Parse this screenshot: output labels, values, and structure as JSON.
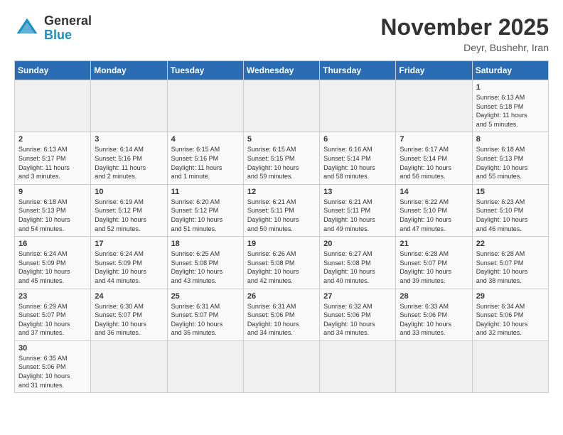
{
  "header": {
    "logo_general": "General",
    "logo_blue": "Blue",
    "month_title": "November 2025",
    "location": "Deyr, Bushehr, Iran"
  },
  "days_of_week": [
    "Sunday",
    "Monday",
    "Tuesday",
    "Wednesday",
    "Thursday",
    "Friday",
    "Saturday"
  ],
  "weeks": [
    [
      {
        "day": "",
        "info": ""
      },
      {
        "day": "",
        "info": ""
      },
      {
        "day": "",
        "info": ""
      },
      {
        "day": "",
        "info": ""
      },
      {
        "day": "",
        "info": ""
      },
      {
        "day": "",
        "info": ""
      },
      {
        "day": "1",
        "info": "Sunrise: 6:13 AM\nSunset: 5:18 PM\nDaylight: 11 hours\nand 5 minutes."
      }
    ],
    [
      {
        "day": "2",
        "info": "Sunrise: 6:13 AM\nSunset: 5:17 PM\nDaylight: 11 hours\nand 3 minutes."
      },
      {
        "day": "3",
        "info": "Sunrise: 6:14 AM\nSunset: 5:16 PM\nDaylight: 11 hours\nand 2 minutes."
      },
      {
        "day": "4",
        "info": "Sunrise: 6:15 AM\nSunset: 5:16 PM\nDaylight: 11 hours\nand 1 minute."
      },
      {
        "day": "5",
        "info": "Sunrise: 6:15 AM\nSunset: 5:15 PM\nDaylight: 10 hours\nand 59 minutes."
      },
      {
        "day": "6",
        "info": "Sunrise: 6:16 AM\nSunset: 5:14 PM\nDaylight: 10 hours\nand 58 minutes."
      },
      {
        "day": "7",
        "info": "Sunrise: 6:17 AM\nSunset: 5:14 PM\nDaylight: 10 hours\nand 56 minutes."
      },
      {
        "day": "8",
        "info": "Sunrise: 6:18 AM\nSunset: 5:13 PM\nDaylight: 10 hours\nand 55 minutes."
      }
    ],
    [
      {
        "day": "9",
        "info": "Sunrise: 6:18 AM\nSunset: 5:13 PM\nDaylight: 10 hours\nand 54 minutes."
      },
      {
        "day": "10",
        "info": "Sunrise: 6:19 AM\nSunset: 5:12 PM\nDaylight: 10 hours\nand 52 minutes."
      },
      {
        "day": "11",
        "info": "Sunrise: 6:20 AM\nSunset: 5:12 PM\nDaylight: 10 hours\nand 51 minutes."
      },
      {
        "day": "12",
        "info": "Sunrise: 6:21 AM\nSunset: 5:11 PM\nDaylight: 10 hours\nand 50 minutes."
      },
      {
        "day": "13",
        "info": "Sunrise: 6:21 AM\nSunset: 5:11 PM\nDaylight: 10 hours\nand 49 minutes."
      },
      {
        "day": "14",
        "info": "Sunrise: 6:22 AM\nSunset: 5:10 PM\nDaylight: 10 hours\nand 47 minutes."
      },
      {
        "day": "15",
        "info": "Sunrise: 6:23 AM\nSunset: 5:10 PM\nDaylight: 10 hours\nand 46 minutes."
      }
    ],
    [
      {
        "day": "16",
        "info": "Sunrise: 6:24 AM\nSunset: 5:09 PM\nDaylight: 10 hours\nand 45 minutes."
      },
      {
        "day": "17",
        "info": "Sunrise: 6:24 AM\nSunset: 5:09 PM\nDaylight: 10 hours\nand 44 minutes."
      },
      {
        "day": "18",
        "info": "Sunrise: 6:25 AM\nSunset: 5:08 PM\nDaylight: 10 hours\nand 43 minutes."
      },
      {
        "day": "19",
        "info": "Sunrise: 6:26 AM\nSunset: 5:08 PM\nDaylight: 10 hours\nand 42 minutes."
      },
      {
        "day": "20",
        "info": "Sunrise: 6:27 AM\nSunset: 5:08 PM\nDaylight: 10 hours\nand 40 minutes."
      },
      {
        "day": "21",
        "info": "Sunrise: 6:28 AM\nSunset: 5:07 PM\nDaylight: 10 hours\nand 39 minutes."
      },
      {
        "day": "22",
        "info": "Sunrise: 6:28 AM\nSunset: 5:07 PM\nDaylight: 10 hours\nand 38 minutes."
      }
    ],
    [
      {
        "day": "23",
        "info": "Sunrise: 6:29 AM\nSunset: 5:07 PM\nDaylight: 10 hours\nand 37 minutes."
      },
      {
        "day": "24",
        "info": "Sunrise: 6:30 AM\nSunset: 5:07 PM\nDaylight: 10 hours\nand 36 minutes."
      },
      {
        "day": "25",
        "info": "Sunrise: 6:31 AM\nSunset: 5:07 PM\nDaylight: 10 hours\nand 35 minutes."
      },
      {
        "day": "26",
        "info": "Sunrise: 6:31 AM\nSunset: 5:06 PM\nDaylight: 10 hours\nand 34 minutes."
      },
      {
        "day": "27",
        "info": "Sunrise: 6:32 AM\nSunset: 5:06 PM\nDaylight: 10 hours\nand 34 minutes."
      },
      {
        "day": "28",
        "info": "Sunrise: 6:33 AM\nSunset: 5:06 PM\nDaylight: 10 hours\nand 33 minutes."
      },
      {
        "day": "29",
        "info": "Sunrise: 6:34 AM\nSunset: 5:06 PM\nDaylight: 10 hours\nand 32 minutes."
      }
    ],
    [
      {
        "day": "30",
        "info": "Sunrise: 6:35 AM\nSunset: 5:06 PM\nDaylight: 10 hours\nand 31 minutes."
      },
      {
        "day": "",
        "info": ""
      },
      {
        "day": "",
        "info": ""
      },
      {
        "day": "",
        "info": ""
      },
      {
        "day": "",
        "info": ""
      },
      {
        "day": "",
        "info": ""
      },
      {
        "day": "",
        "info": ""
      }
    ]
  ]
}
